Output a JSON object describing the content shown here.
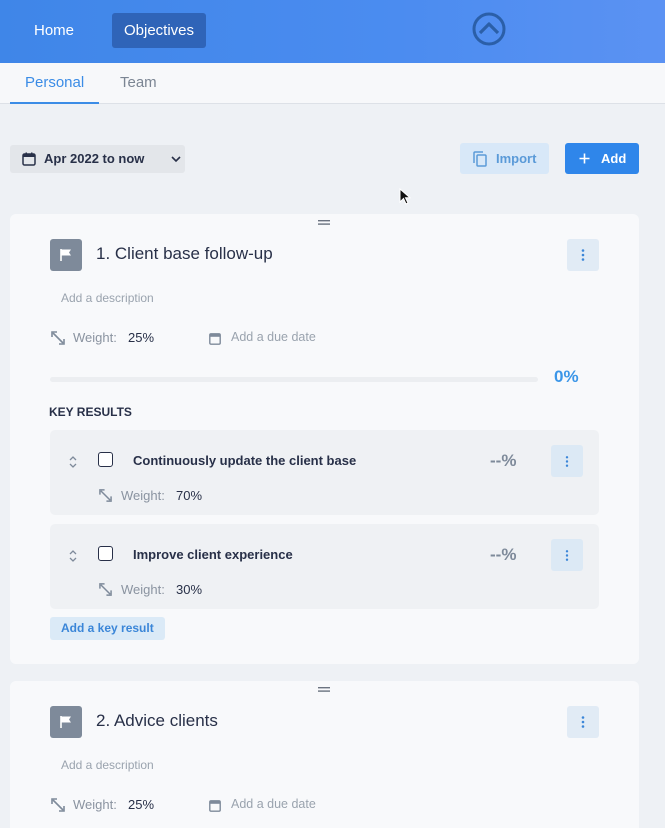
{
  "nav": {
    "home": "Home",
    "objectives": "Objectives"
  },
  "tabs": {
    "personal": "Personal",
    "team": "Team"
  },
  "toolbar": {
    "date_range": "Apr 2022 to now",
    "import_label": "Import",
    "add_label": "Add"
  },
  "colors": {
    "accent": "#2f86ea",
    "topbar": "#4b8cf0",
    "active_nav": "#2f64b8"
  },
  "objectives": [
    {
      "title": "1. Client base follow-up",
      "description_placeholder": "Add a description",
      "weight_label": "Weight:",
      "weight": "25%",
      "due_placeholder": "Add a due date",
      "progress": "0%",
      "key_results_heading": "KEY RESULTS",
      "key_results": [
        {
          "title": "Continuously update the client base",
          "progress": "--%",
          "weight_label": "Weight:",
          "weight": "70%"
        },
        {
          "title": "Improve client experience",
          "progress": "--%",
          "weight_label": "Weight:",
          "weight": "30%"
        }
      ],
      "add_key_result": "Add a key result"
    },
    {
      "title": "2. Advice clients",
      "description_placeholder": "Add a description",
      "weight_label": "Weight:",
      "weight": "25%",
      "due_placeholder": "Add a due date"
    }
  ]
}
